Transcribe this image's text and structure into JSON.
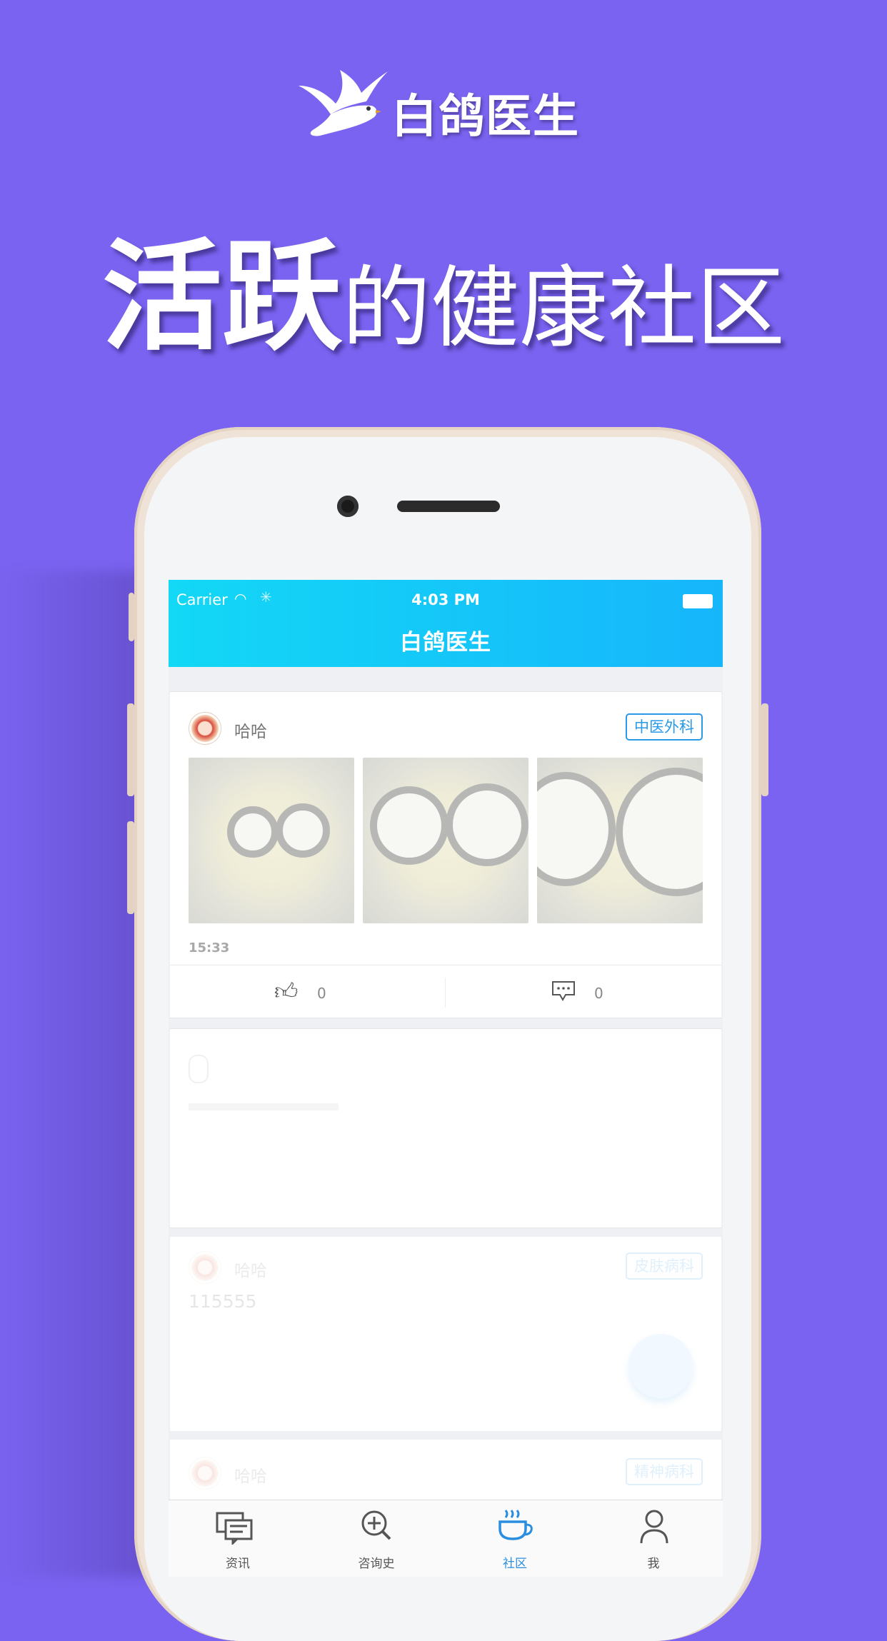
{
  "promo": {
    "brand_name": "白鸽医生",
    "headline_bold": "活跃",
    "headline_regular": "的健康社区"
  },
  "status_bar": {
    "carrier": "Carrier",
    "time": "4:03 PM"
  },
  "navbar": {
    "title": "白鸽医生"
  },
  "posts": [
    {
      "username": "哈哈",
      "tag": "中医外科",
      "time": "15:33",
      "like_count": "0",
      "comment_count": "0"
    },
    {
      "username": "哈哈",
      "tag": "皮肤病科",
      "text": "115555"
    },
    {
      "username": "哈哈",
      "tag": "精神病科"
    }
  ],
  "tabbar": {
    "items": [
      {
        "label": "资讯",
        "icon": "news-icon"
      },
      {
        "label": "咨询史",
        "icon": "consult-history-icon"
      },
      {
        "label": "社区",
        "icon": "coffee-cup-icon",
        "active": true
      },
      {
        "label": "我",
        "icon": "profile-icon"
      }
    ]
  },
  "colors": {
    "background": "#7a63f0",
    "navbar_start": "#13d8f6",
    "navbar_end": "#16b6fb",
    "accent": "#2a9ae8"
  }
}
